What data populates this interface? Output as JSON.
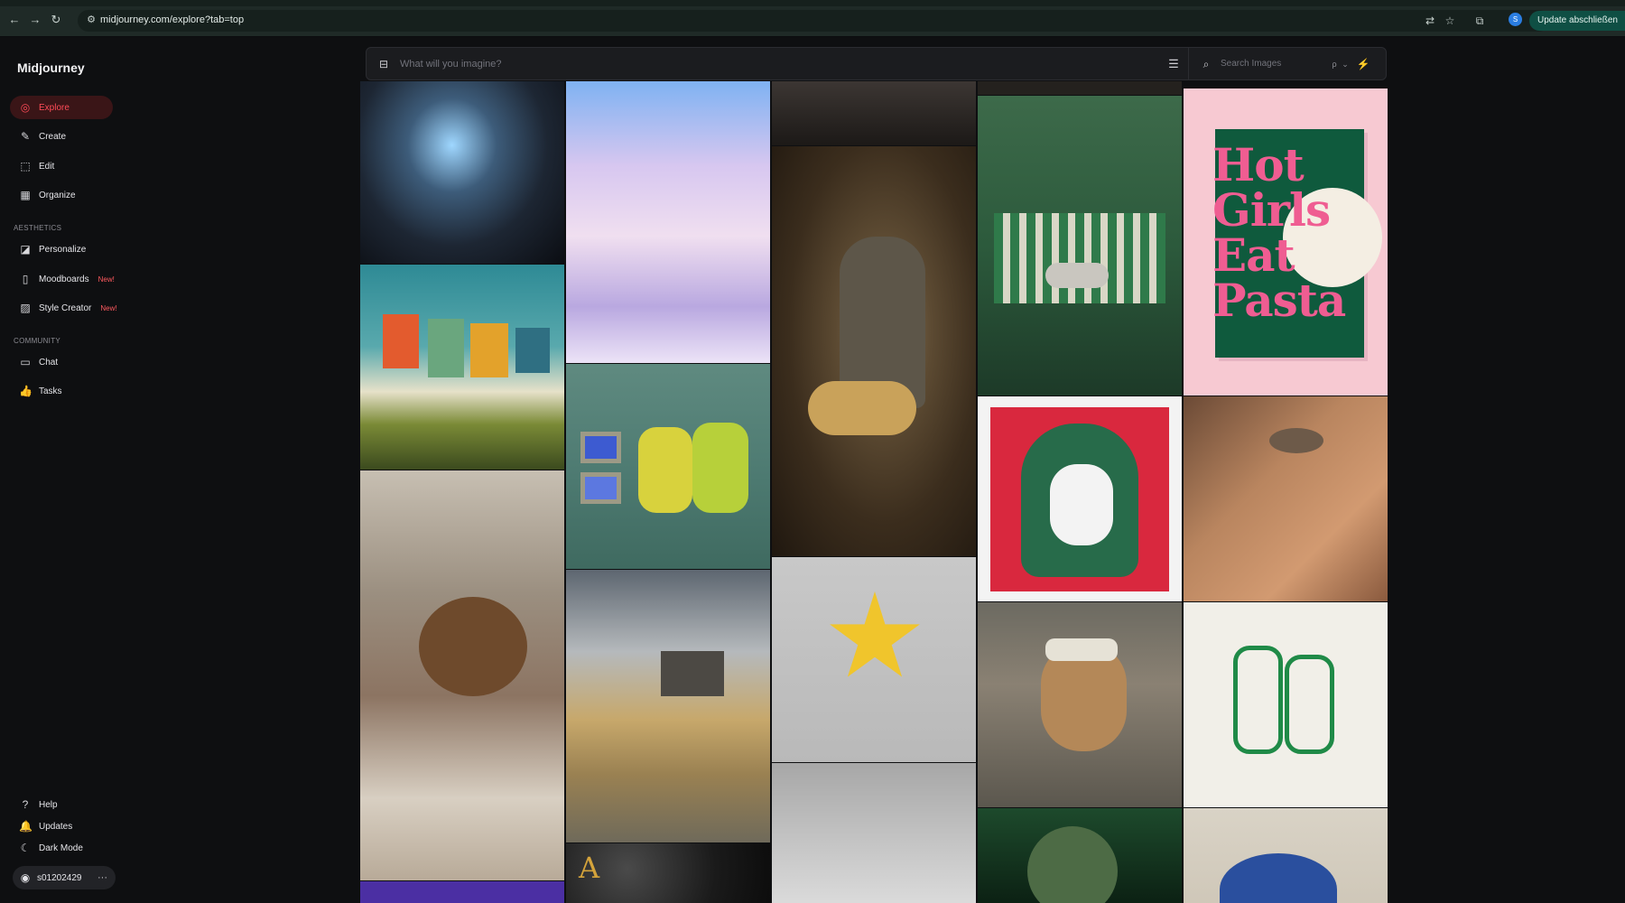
{
  "browser": {
    "url": "midjourney.com/explore?tab=top",
    "update_label": "Update abschließen",
    "profile_initial": "S"
  },
  "sidebar": {
    "logo": "Midjourney",
    "nav": [
      {
        "label": "Explore",
        "icon": "compass-icon",
        "active": true
      },
      {
        "label": "Create",
        "icon": "brush-icon"
      },
      {
        "label": "Edit",
        "icon": "edit-icon"
      },
      {
        "label": "Organize",
        "icon": "grid-icon"
      }
    ],
    "aesthetics_label": "AESTHETICS",
    "aesthetics": [
      {
        "label": "Personalize",
        "icon": "palette-icon"
      },
      {
        "label": "Moodboards",
        "icon": "moodboard-icon",
        "badge": "New!"
      },
      {
        "label": "Style Creator",
        "icon": "style-icon",
        "badge": "New!"
      }
    ],
    "community_label": "COMMUNITY",
    "community": [
      {
        "label": "Chat",
        "icon": "chat-icon"
      },
      {
        "label": "Tasks",
        "icon": "thumbs-up-icon"
      }
    ],
    "footer": [
      {
        "label": "Help",
        "icon": "help-icon"
      },
      {
        "label": "Updates",
        "icon": "bell-icon"
      },
      {
        "label": "Dark Mode",
        "icon": "moon-icon"
      }
    ],
    "user": {
      "name": "s01202429",
      "more": "···"
    }
  },
  "toolbar": {
    "prompt_placeholder": "What will you imagine?",
    "search_placeholder": "Search Images"
  },
  "gallery": {
    "poster_text": "Hot Girls Eat Pasta",
    "tiles": [
      "mermaid-statue",
      "laundry-line",
      "child-drawing",
      "purple-tile",
      "crystal-palace",
      "monsters-tv",
      "abandoned-house",
      "gold-letters",
      "dark-sculpture",
      "angel-statue",
      "felt-star",
      "grey-tile",
      "dark-tile",
      "green-sofa-cat",
      "gorilla-logo",
      "cat-cashier",
      "alien-portrait",
      "pasta-poster",
      "skin-closeup",
      "green-bags",
      "blue-embroidery"
    ]
  },
  "colors": {
    "accent": "#ff4b57",
    "background": "#0e0f11",
    "update_button": "#0f4f44"
  }
}
